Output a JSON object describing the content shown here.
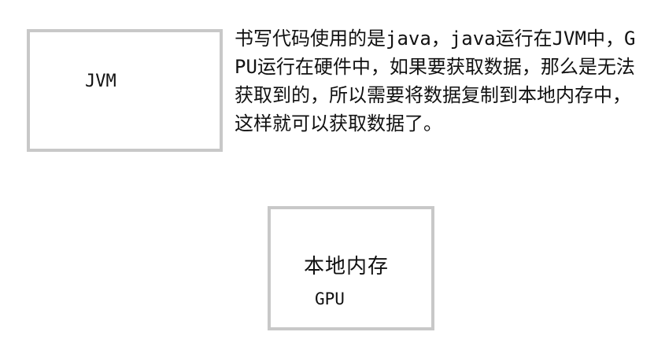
{
  "diagram": {
    "jvm_box": {
      "label": "JVM"
    },
    "description": "书写代码使用的是java，java运行在JVM中，GPU运行在硬件中，如果要获取数据，那么是无法获取到的，所以需要将数据复制到本地内存中，这样就可以获取数据了。",
    "memory_box": {
      "label": "本地内存",
      "sublabel": "GPU"
    }
  },
  "colors": {
    "box_border": "#c8c8c8",
    "text": "#111111",
    "background": "#ffffff"
  }
}
